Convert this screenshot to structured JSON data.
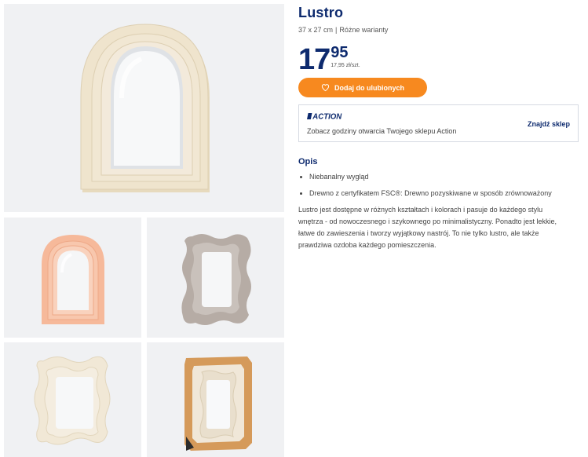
{
  "product": {
    "title": "Lustro",
    "dimensions": "37 x 27 cm",
    "separator": "|",
    "variants": "Różne warianty"
  },
  "price": {
    "integer": "17",
    "decimal": "95",
    "unit_price": "17,95 zł/szt."
  },
  "favorite_button": {
    "label": "Dodaj do ulubionych",
    "icon": "heart-icon"
  },
  "store": {
    "logo_text": "ACTION",
    "text": "Zobacz godziny otwarcia Twojego sklepu Action",
    "link": "Znajdź sklep"
  },
  "description": {
    "heading": "Opis",
    "features": [
      "Niebanalny wygląd",
      "Drewno z certyfikatem FSC®: Drewno pozyskiwane w sposób zrównoważony"
    ],
    "text": "Lustro jest dostępne w różnych kształtach i kolorach i pasuje do każdego stylu wnętrza - od nowoczesnego i szykownego po minimalistyczny. Ponadto jest lekkie, łatwe do zawieszenia i tworzy wyjątkowy nastrój. To nie tylko lustro, ale także prawdziwa ozdoba każdego pomieszczenia."
  },
  "colors": {
    "brand_blue": "#0d2a6e",
    "accent_orange": "#f7891f",
    "tile_background": "#f0f1f3",
    "frame_beige": "#efe4cd",
    "frame_peach": "#f6b99a",
    "frame_taupe": "#b6aca5",
    "frame_cream": "#f1e8d6",
    "box_kraft": "#d59a5a"
  }
}
